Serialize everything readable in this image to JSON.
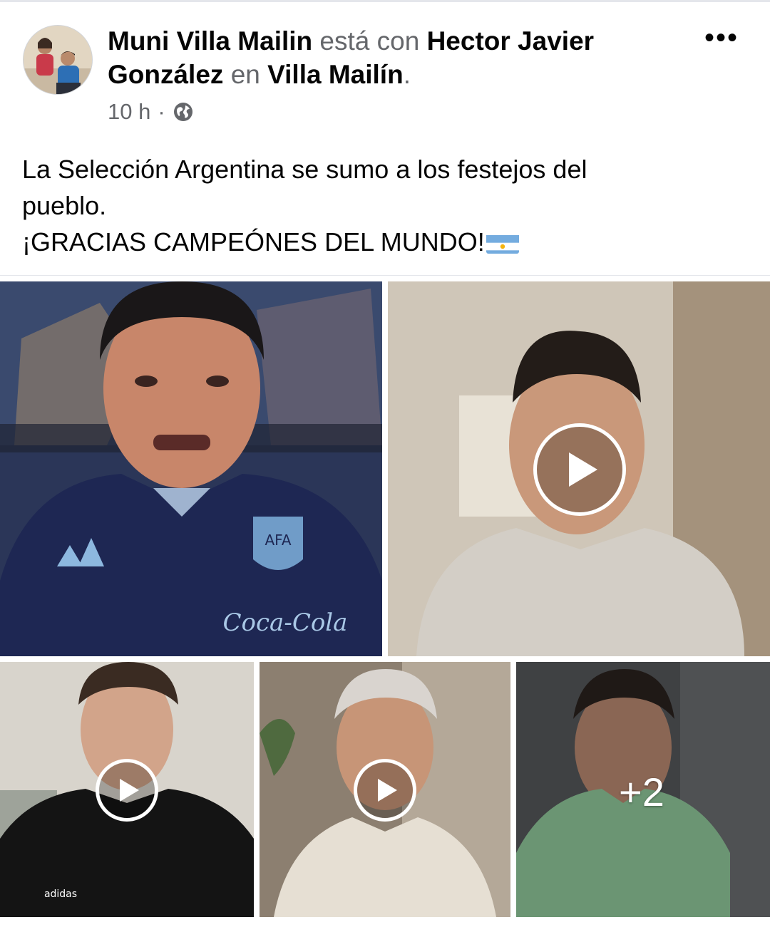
{
  "post": {
    "author": "Muni Villa Mailin",
    "with_connector": "está con",
    "tagged_person": "Hector Javier González",
    "tagged_person_line1": "Hector Javier",
    "tagged_person_line2": "González",
    "location_connector": "en",
    "location": "Villa Mailín",
    "end_punct": ".",
    "time": "10 h",
    "meta_separator": "·",
    "audience_icon": "globe-icon",
    "more_icon": "more-options-icon",
    "more_label": "•••",
    "message_lines": [
      "La Selección Argentina se sumo a los festejos del",
      "pueblo.",
      "¡GRACIAS CAMPEÓNES DEL MUNDO!"
    ],
    "message_emoji": "argentina-flag-emoji"
  },
  "media": {
    "items": [
      {
        "kind": "photo",
        "description_icon": "photo-thumbnail"
      },
      {
        "kind": "video",
        "play_icon": "play-icon"
      },
      {
        "kind": "video",
        "play_icon": "play-icon"
      },
      {
        "kind": "video",
        "play_icon": "play-icon"
      },
      {
        "kind": "more",
        "overlay_text": "+2"
      }
    ]
  },
  "colors": {
    "text_primary": "#050505",
    "text_secondary": "#65676b",
    "divider": "#e4e6eb",
    "flag_blue": "#74acdf"
  }
}
